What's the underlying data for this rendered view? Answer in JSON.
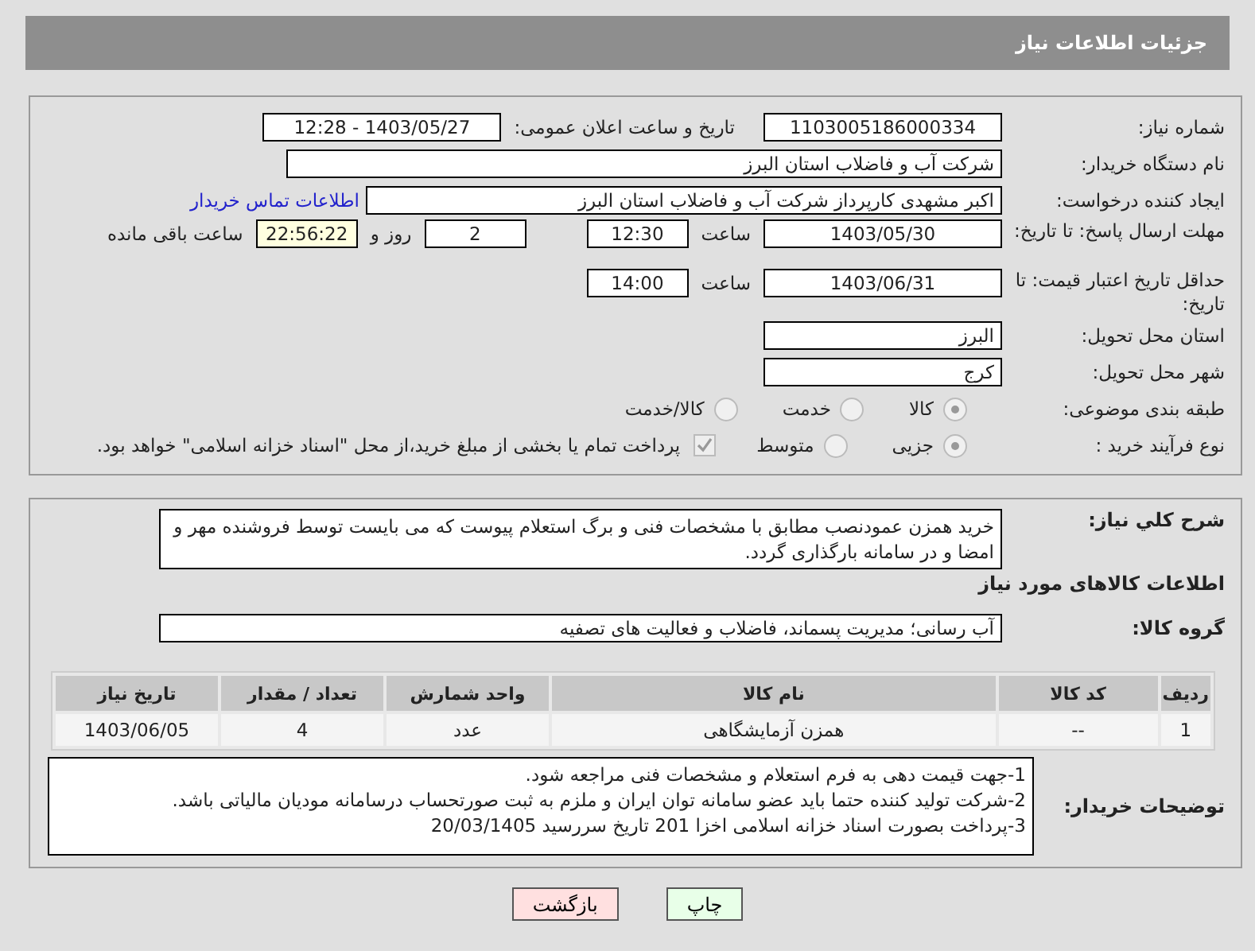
{
  "header": {
    "title": "جزئیات اطلاعات نیاز"
  },
  "need_number": {
    "label": "شماره نیاز:",
    "value": "1103005186000334"
  },
  "announce": {
    "label": "تاریخ و ساعت اعلان عمومی:",
    "value": "1403/05/27 - 12:28"
  },
  "buyer": {
    "label": "نام دستگاه خریدار:",
    "value": "شرکت آب و فاضلاب استان البرز"
  },
  "requester": {
    "label": "ایجاد کننده درخواست:",
    "value": "اکبر مشهدی کارپرداز شرکت آب و فاضلاب استان البرز",
    "link": "اطلاعات تماس خریدار"
  },
  "deadline": {
    "label": "مهلت ارسال پاسخ: تا تاریخ:",
    "date": "1403/05/30",
    "time_label": "ساعت",
    "time": "12:30",
    "days": "2",
    "days_label": "روز و",
    "remaining": "22:56:22",
    "remaining_label": "ساعت باقی مانده"
  },
  "validity": {
    "label": "حداقل تاریخ اعتبار قیمت: تا تاریخ:",
    "date": "1403/06/31",
    "time_label": "ساعت",
    "time": "14:00"
  },
  "province": {
    "label": "استان محل تحویل:",
    "value": "البرز"
  },
  "city": {
    "label": "شهر محل تحویل:",
    "value": "کرج"
  },
  "category": {
    "label": "طبقه بندی موضوعی:",
    "options": [
      {
        "label": "کالا",
        "selected": true
      },
      {
        "label": "خدمت",
        "selected": false
      },
      {
        "label": "کالا/خدمت",
        "selected": false
      }
    ]
  },
  "process": {
    "label": "نوع فرآیند خرید :",
    "options": [
      {
        "label": "جزیی",
        "selected": true
      },
      {
        "label": "متوسط",
        "selected": false
      }
    ],
    "treasury": {
      "checked": true,
      "label": "پرداخت تمام یا بخشی از مبلغ خرید،از محل \"اسناد خزانه اسلامی\" خواهد بود."
    }
  },
  "description": {
    "label": "شرح کلي نياز:",
    "value": "خرید همزن عمودنصب مطابق با مشخصات فنی و برگ استعلام پیوست که می بایست توسط فروشنده مهر و امضا و در سامانه بارگذاری گردد."
  },
  "goods_heading": "اطلاعات کالاهای مورد نیاز",
  "goods_group": {
    "label": "گروه کالا:",
    "value": "آب رسانی؛ مدیریت پسماند، فاضلاب و فعالیت های تصفیه"
  },
  "table": {
    "columns": [
      "ردیف",
      "کد کالا",
      "نام کالا",
      "واحد شمارش",
      "تعداد / مقدار",
      "تاریخ نیاز"
    ],
    "rows": [
      [
        "1",
        "--",
        "همزن آزمایشگاهی",
        "عدد",
        "4",
        "1403/06/05"
      ]
    ]
  },
  "notes": {
    "label": "توضیحات خریدار:",
    "lines": [
      "1-جهت قیمت دهی به فرم استعلام و مشخصات فنی مراجعه شود.",
      "2-شرکت تولید کننده حتما باید عضو سامانه توان ایران و ملزم به ثبت صورتحساب درسامانه مودیان مالیاتی باشد.",
      "3-پرداخت بصورت اسناد خزانه اسلامی اخزا 201 تاریخ سررسید 20/03/1405"
    ]
  },
  "buttons": [
    {
      "label": "چاپ",
      "kind": "print"
    },
    {
      "label": "بازگشت",
      "kind": "back"
    }
  ]
}
